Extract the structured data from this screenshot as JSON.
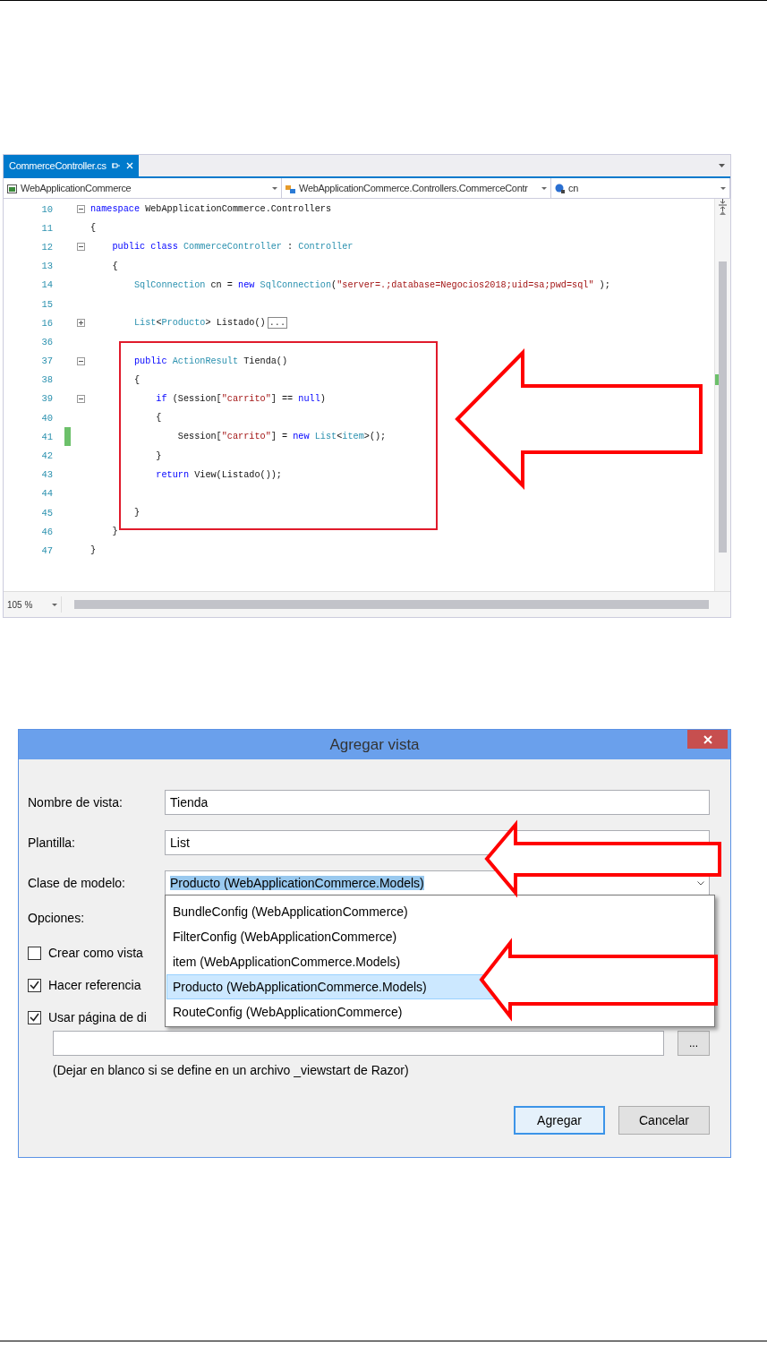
{
  "editor": {
    "tab": {
      "label": "CommerceController.cs"
    },
    "nav": [
      "WebApplicationCommerce",
      "WebApplicationCommerce.Controllers.CommerceContr",
      "cn"
    ],
    "lines": [
      {
        "number": "10",
        "collapsed": false,
        "changed": false,
        "code": [
          {
            "kind": "kw",
            "text": "namespace "
          },
          {
            "kind": "plain",
            "text": "WebApplicationCommerce.Controllers"
          }
        ]
      },
      {
        "number": "11",
        "changed": false,
        "code": [
          {
            "kind": "plain",
            "text": "{"
          }
        ]
      },
      {
        "number": "12",
        "collapsed": false,
        "changed": false,
        "code": [
          {
            "kind": "kw",
            "text": "    public class "
          },
          {
            "kind": "type",
            "text": "CommerceController"
          },
          {
            "kind": "plain",
            "text": " : "
          },
          {
            "kind": "type",
            "text": "Controller"
          }
        ]
      },
      {
        "number": "13",
        "changed": false,
        "code": [
          {
            "kind": "plain",
            "text": "    {"
          }
        ]
      },
      {
        "number": "14",
        "changed": false,
        "code": [
          {
            "kind": "type",
            "text": "        SqlConnection"
          },
          {
            "kind": "plain",
            "text": " cn = "
          },
          {
            "kind": "kw",
            "text": "new "
          },
          {
            "kind": "type",
            "text": "SqlConnection"
          },
          {
            "kind": "plain",
            "text": "("
          },
          {
            "kind": "str",
            "text": "\"server=.;database=Negocios2018;uid=sa;pwd=sql\""
          },
          {
            "kind": "plain",
            "text": " );"
          }
        ]
      },
      {
        "number": "15",
        "changed": false
      },
      {
        "number": "16",
        "collapsed": true,
        "changed": false,
        "code": [
          {
            "kind": "type",
            "text": "        List"
          },
          {
            "kind": "plain",
            "text": "<"
          },
          {
            "kind": "type",
            "text": "Producto"
          },
          {
            "kind": "plain",
            "text": "> Listado()"
          },
          {
            "kind": "collapsed",
            "text": "..."
          }
        ]
      },
      {
        "number": "36",
        "changed": false
      },
      {
        "number": "37",
        "collapsed": false,
        "changed": false,
        "code": [
          {
            "kind": "kw",
            "text": "        public "
          },
          {
            "kind": "type",
            "text": "ActionResult"
          },
          {
            "kind": "plain",
            "text": " Tienda()"
          }
        ]
      },
      {
        "number": "38",
        "changed": false,
        "code": [
          {
            "kind": "plain",
            "text": "        {"
          }
        ]
      },
      {
        "number": "39",
        "collapsed": false,
        "changed": false,
        "code": [
          {
            "kind": "kw",
            "text": "            if"
          },
          {
            "kind": "plain",
            "text": " (Session["
          },
          {
            "kind": "str",
            "text": "\"carrito\""
          },
          {
            "kind": "plain",
            "text": "] == "
          },
          {
            "kind": "kw",
            "text": "null"
          },
          {
            "kind": "plain",
            "text": ")"
          }
        ]
      },
      {
        "number": "40",
        "changed": false,
        "code": [
          {
            "kind": "plain",
            "text": "            {"
          }
        ]
      },
      {
        "number": "41",
        "changed": true,
        "code": [
          {
            "kind": "plain",
            "text": "                Session["
          },
          {
            "kind": "str",
            "text": "\"carrito\""
          },
          {
            "kind": "plain",
            "text": "] = "
          },
          {
            "kind": "kw",
            "text": "new "
          },
          {
            "kind": "type",
            "text": "List"
          },
          {
            "kind": "plain",
            "text": "<"
          },
          {
            "kind": "type",
            "text": "item"
          },
          {
            "kind": "plain",
            "text": ">();"
          }
        ]
      },
      {
        "number": "42",
        "changed": false,
        "code": [
          {
            "kind": "plain",
            "text": "            }"
          }
        ]
      },
      {
        "number": "43",
        "changed": false,
        "code": [
          {
            "kind": "kw",
            "text": "            return"
          },
          {
            "kind": "plain",
            "text": " View(Listado());"
          }
        ]
      },
      {
        "number": "44",
        "changed": false
      },
      {
        "number": "45",
        "changed": false,
        "code": [
          {
            "kind": "plain",
            "text": "        }"
          }
        ]
      },
      {
        "number": "46",
        "changed": false,
        "code": [
          {
            "kind": "plain",
            "text": "    }"
          }
        ]
      },
      {
        "number": "47",
        "changed": false,
        "code": [
          {
            "kind": "plain",
            "text": "}"
          }
        ]
      }
    ],
    "zoom": "105 %"
  },
  "dialog": {
    "title": "Agregar vista",
    "fields": [
      {
        "kind": "text",
        "label": "Nombre de vista:",
        "value": "Tienda"
      },
      {
        "kind": "text",
        "label": "Plantilla:",
        "value": "List"
      },
      {
        "kind": "combo",
        "label": "Clase de modelo:",
        "value": "Producto (WebApplicationCommerce.Models)",
        "expanded": true,
        "options": [
          {
            "text": "BundleConfig (WebApplicationCommerce)",
            "selected": false
          },
          {
            "text": "FilterConfig (WebApplicationCommerce)",
            "selected": false
          },
          {
            "text": "item (WebApplicationCommerce.Models)",
            "selected": false
          },
          {
            "text": "Producto (WebApplicationCommerce.Models)",
            "selected": true
          },
          {
            "text": "RouteConfig (WebApplicationCommerce)",
            "selected": false
          }
        ]
      }
    ],
    "options_label": "Opciones:",
    "checkboxes": [
      {
        "label": "Crear como vista",
        "checked": false
      },
      {
        "label": "Hacer referencia",
        "checked": true
      },
      {
        "label": "Usar página de di",
        "checked": true
      }
    ],
    "browse_button": "...",
    "hint": "(Dejar en blanco si se define en un archivo _viewstart de Razor)",
    "buttons": [
      {
        "label": "Agregar",
        "default": true
      },
      {
        "label": "Cancelar",
        "default": false
      }
    ]
  }
}
